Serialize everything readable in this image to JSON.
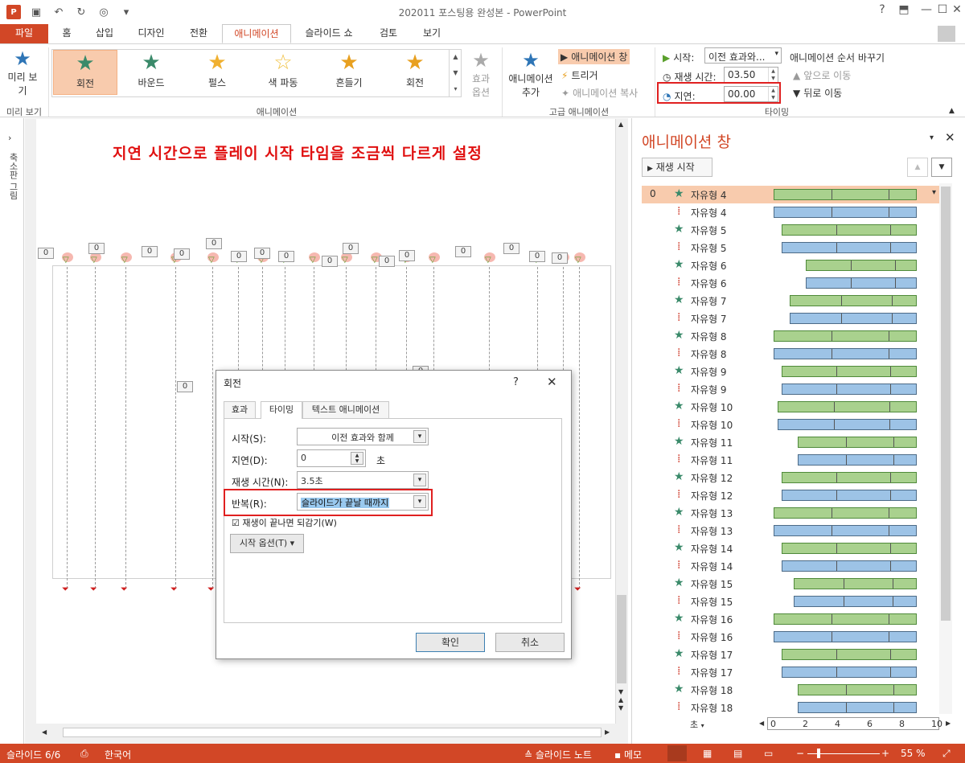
{
  "app": {
    "window_title": "202011 포스팅용 완성본 - PowerPoint",
    "logo": "P"
  },
  "tabs": [
    {
      "label": "파일"
    },
    {
      "label": "홈"
    },
    {
      "label": "삽입"
    },
    {
      "label": "디자인"
    },
    {
      "label": "전환"
    },
    {
      "label": "애니메이션"
    },
    {
      "label": "슬라이드 쇼"
    },
    {
      "label": "검토"
    },
    {
      "label": "보기"
    }
  ],
  "ribbon": {
    "preview": {
      "line1": "미리 보",
      "line2": "기",
      "group": "미리 보기"
    },
    "effects": [
      {
        "label": "회전"
      },
      {
        "label": "바운드"
      },
      {
        "label": "펄스"
      },
      {
        "label": "색 파동"
      },
      {
        "label": "흔들기"
      },
      {
        "label": "회전"
      }
    ],
    "effects_group": "애니메이션",
    "effect_options": {
      "line1": "효과",
      "line2": "옵션"
    },
    "advanced": {
      "add_line1": "애니메이션",
      "add_line2": "추가",
      "pane": "애니메이션 창",
      "trigger": "트리거",
      "painter": "애니메이션 복사",
      "group": "고급 애니메이션"
    },
    "timing": {
      "start_label": "시작:",
      "start_value": "이전 효과와...",
      "duration_label": "재생 시간:",
      "duration_value": "03.50",
      "delay_label": "지연:",
      "delay_value": "00.00",
      "reorder": "애니메이션 순서 바꾸기",
      "move_earlier": "앞으로 이동",
      "move_later": "뒤로 이동",
      "group": "타이밍"
    }
  },
  "left_panel": {
    "label": "축소판 그림"
  },
  "slide": {
    "instruction": "지연 시간으로 플레이 시작 타임을 조금씩 다르게 설정",
    "tag_value": "0"
  },
  "dialog": {
    "title": "회전",
    "help": "?",
    "close": "✕",
    "tabs": [
      "효과",
      "타이밍",
      "텍스트 애니메이션"
    ],
    "start_label": "시작(S):",
    "start_value": "이전 효과와 함께",
    "delay_label": "지연(D):",
    "delay_value": "0",
    "delay_unit": "초",
    "duration_label": "재생 시간(N):",
    "duration_value": "3.5초",
    "repeat_label": "반복(R):",
    "repeat_value": "슬라이드가 끝날 때까지",
    "rewind_label": "재생이 끝나면 되감기(W)",
    "triggers_label": "시작 옵션(T)",
    "ok": "확인",
    "cancel": "취소"
  },
  "pane": {
    "title": "애니메이션 창",
    "play": "재생 시작",
    "rows": [
      {
        "num": "0",
        "name": "자유형 4",
        "kind": "g"
      },
      {
        "num": "",
        "name": "자유형 4",
        "kind": "b"
      },
      {
        "num": "",
        "name": "자유형 5",
        "kind": "g"
      },
      {
        "num": "",
        "name": "자유형 5",
        "kind": "b"
      },
      {
        "num": "",
        "name": "자유형 6",
        "kind": "g"
      },
      {
        "num": "",
        "name": "자유형 6",
        "kind": "b"
      },
      {
        "num": "",
        "name": "자유형 7",
        "kind": "g"
      },
      {
        "num": "",
        "name": "자유형 7",
        "kind": "b"
      },
      {
        "num": "",
        "name": "자유형 8",
        "kind": "g"
      },
      {
        "num": "",
        "name": "자유형 8",
        "kind": "b"
      },
      {
        "num": "",
        "name": "자유형 9",
        "kind": "g"
      },
      {
        "num": "",
        "name": "자유형 9",
        "kind": "b"
      },
      {
        "num": "",
        "name": "자유형 10",
        "kind": "g"
      },
      {
        "num": "",
        "name": "자유형 10",
        "kind": "b"
      },
      {
        "num": "",
        "name": "자유형 11",
        "kind": "g"
      },
      {
        "num": "",
        "name": "자유형 11",
        "kind": "b"
      },
      {
        "num": "",
        "name": "자유형 12",
        "kind": "g"
      },
      {
        "num": "",
        "name": "자유형 12",
        "kind": "b"
      },
      {
        "num": "",
        "name": "자유형 13",
        "kind": "g"
      },
      {
        "num": "",
        "name": "자유형 13",
        "kind": "b"
      },
      {
        "num": "",
        "name": "자유형 14",
        "kind": "g"
      },
      {
        "num": "",
        "name": "자유형 14",
        "kind": "b"
      },
      {
        "num": "",
        "name": "자유형 15",
        "kind": "g"
      },
      {
        "num": "",
        "name": "자유형 15",
        "kind": "b"
      },
      {
        "num": "",
        "name": "자유형 16",
        "kind": "g"
      },
      {
        "num": "",
        "name": "자유형 16",
        "kind": "b"
      },
      {
        "num": "",
        "name": "자유형 17",
        "kind": "g"
      },
      {
        "num": "",
        "name": "자유형 17",
        "kind": "b"
      },
      {
        "num": "",
        "name": "자유형 18",
        "kind": "g"
      },
      {
        "num": "",
        "name": "자유형 18",
        "kind": "b"
      }
    ],
    "timeline": {
      "unit": "초",
      "ticks": [
        "0",
        "2",
        "4",
        "6",
        "8",
        "10"
      ]
    }
  },
  "status": {
    "slide": "슬라이드 6/6",
    "language": "한국어",
    "notes": "슬라이드 노트",
    "comments": "메모",
    "zoom": "55 %"
  },
  "colors": {
    "accent": "#d24726",
    "highlight": "#f8cbad",
    "redbox": "#e02020"
  }
}
